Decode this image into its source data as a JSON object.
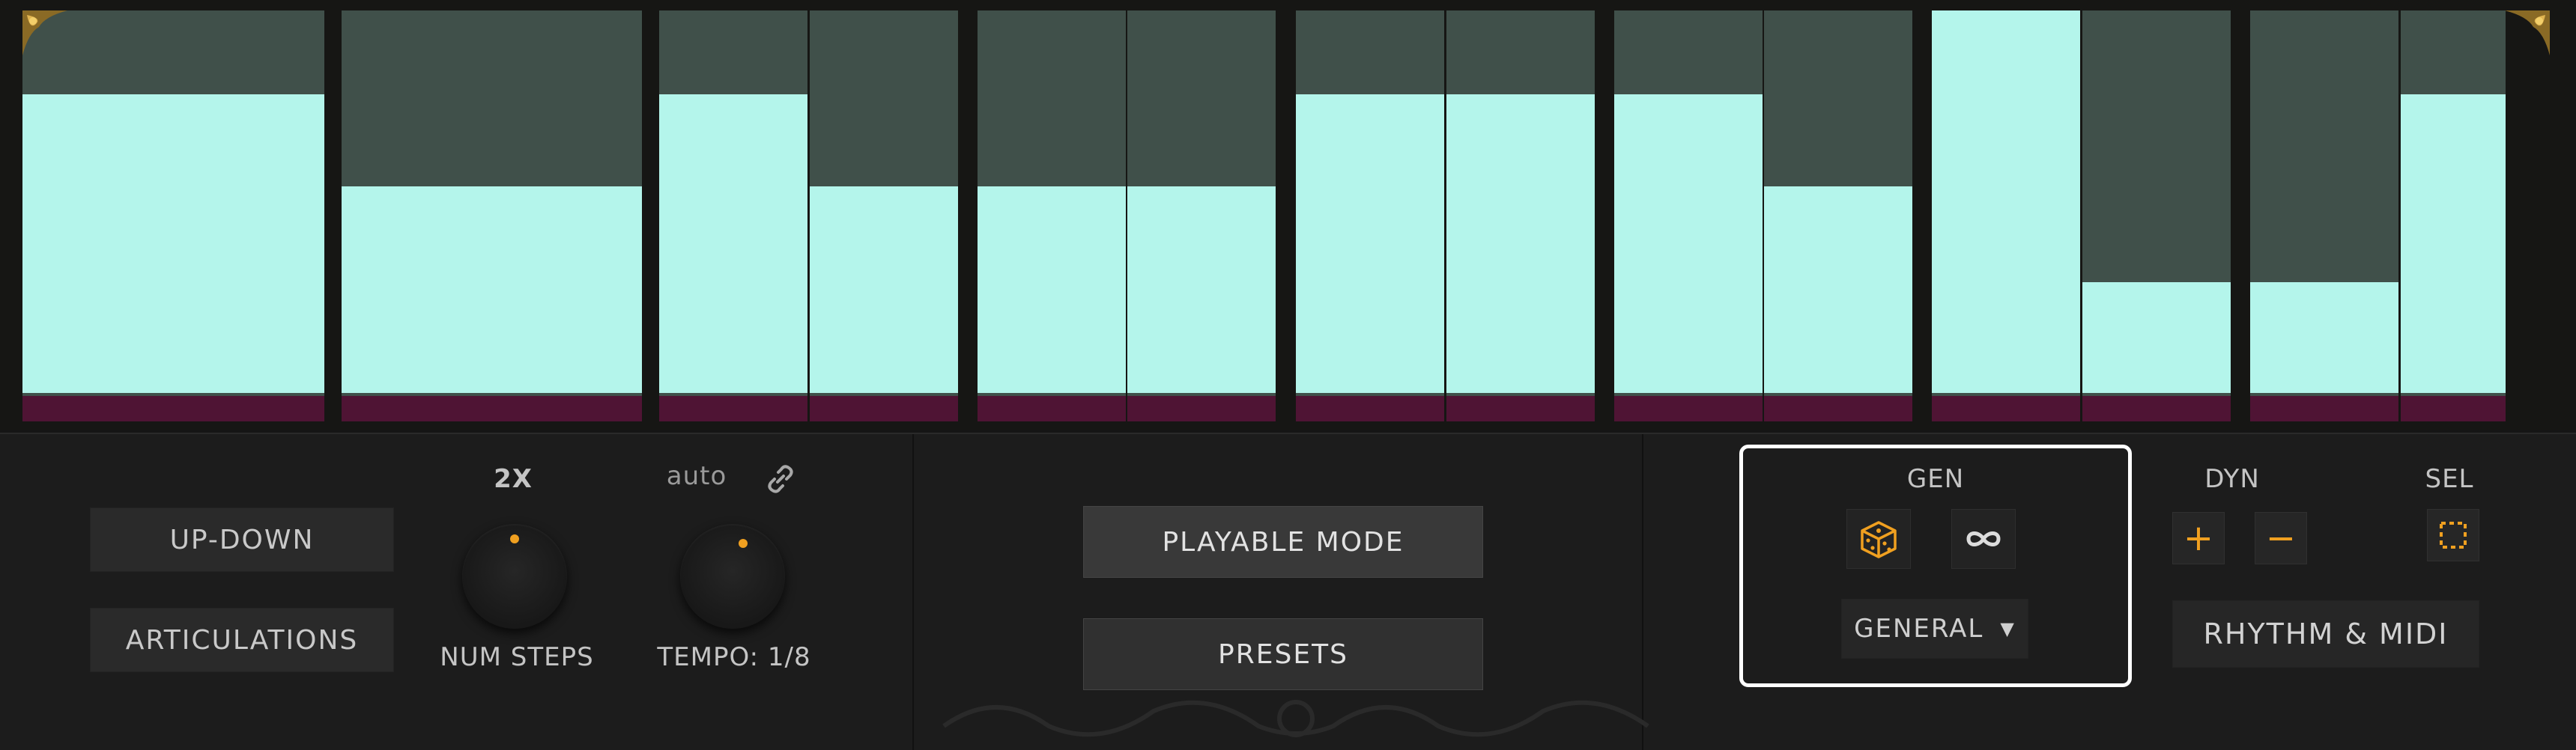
{
  "sequencer": {
    "steps": [
      {
        "level": 0.78,
        "merged": true
      },
      {
        "level": 0.54,
        "merged": true
      },
      {
        "level": 0.78
      },
      {
        "level": 0.54
      },
      {
        "level": 0.54
      },
      {
        "level": 0.54
      },
      {
        "level": 0.78
      },
      {
        "level": 0.78
      },
      {
        "level": 0.78
      },
      {
        "level": 0.54
      },
      {
        "level": 1.0
      },
      {
        "level": 0.29
      },
      {
        "level": 0.29
      },
      {
        "level": 0.78
      }
    ],
    "colors": {
      "fill": "#b4f5eb",
      "empty": "#40504a",
      "accent": "#4f1434",
      "ornament": "#c49a3a"
    }
  },
  "panel": {
    "up_down_label": "UP-DOWN",
    "articulations_label": "ARTICULATIONS",
    "num_steps": {
      "mult_label": "2X",
      "label": "NUM STEPS"
    },
    "tempo": {
      "sync_label": "auto",
      "label": "TEMPO: 1/8"
    },
    "playable_mode_label": "PLAYABLE MODE",
    "presets_label": "PRESETS",
    "gen": {
      "title": "GEN",
      "dice_icon": "dice-icon",
      "infinity_icon": "infinity-icon",
      "dropdown_value": "GENERAL"
    },
    "dyn": {
      "title": "DYN",
      "plus": "+",
      "minus": "−"
    },
    "sel": {
      "title": "SEL"
    },
    "rhythm_midi_label": "RHYTHM & MIDI"
  },
  "accent_color": "#f0a020"
}
